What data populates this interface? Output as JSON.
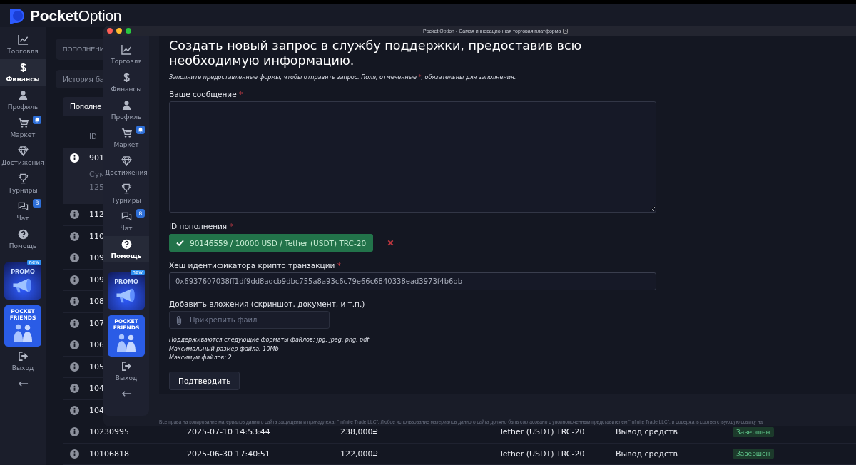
{
  "app": {
    "logo": "**Pocket**Option",
    "sidebar": {
      "items": [
        {
          "label": "Торговля",
          "selected": false
        },
        {
          "label": "Финансы",
          "selected": true
        },
        {
          "label": "Профиль",
          "selected": false
        },
        {
          "label": "Маркет",
          "selected": false,
          "alert": true
        },
        {
          "label": "Достижения",
          "selected": false
        },
        {
          "label": "Турниры",
          "selected": false
        },
        {
          "label": "Чат",
          "selected": false,
          "badge": "8"
        },
        {
          "label": "Помощь",
          "selected": false
        }
      ],
      "promo": {
        "label": "PROMO",
        "badge": "new"
      },
      "friends": {
        "label": "POCKET FRIENDS"
      },
      "logout": "Выход"
    },
    "tabs": [
      "ПОПОЛНЕНИ",
      "История ба"
    ],
    "filter": "Пополне",
    "table": {
      "columns": [
        "ID"
      ],
      "rows": [
        {
          "id": "901",
          "expanded": true,
          "details": [
            "Сум",
            "125"
          ]
        },
        {
          "id": "112",
          "expanded": false
        },
        {
          "id": "110",
          "expanded": false
        },
        {
          "id": "109",
          "expanded": false
        },
        {
          "id": "109",
          "expanded": false
        },
        {
          "id": "108",
          "expanded": false
        },
        {
          "id": "107",
          "expanded": false
        },
        {
          "id": "106",
          "expanded": false
        },
        {
          "id": "105",
          "expanded": false
        },
        {
          "id": "104",
          "expanded": false
        },
        {
          "id": "104",
          "expanded": false
        },
        {
          "id": "10230995",
          "expanded": false,
          "date": "2025-07-10 14:53:44",
          "amount": "238,000₽",
          "method": "Tether (USDT) TRC-20",
          "type": "Вывод средств",
          "status": "Завершен"
        },
        {
          "id": "10106818",
          "expanded": false,
          "date": "2025-06-30 17:40:51",
          "amount": "122,000₽",
          "method": "Tether (USDT) TRC-20",
          "type": "Вывод средств",
          "status": "Завершен"
        }
      ]
    }
  },
  "window": {
    "title": "Pocket Option - Самая инновационная торговая платформа",
    "sidebar": {
      "items": [
        {
          "label": "Торговля",
          "selected": false
        },
        {
          "label": "Финансы",
          "selected": false
        },
        {
          "label": "Профиль",
          "selected": false
        },
        {
          "label": "Маркет",
          "selected": false,
          "alert": true
        },
        {
          "label": "Достижения",
          "selected": false
        },
        {
          "label": "Турниры",
          "selected": false
        },
        {
          "label": "Чат",
          "selected": false,
          "badge": "8"
        },
        {
          "label": "Помощь",
          "selected": true
        }
      ],
      "promo": {
        "label": "PROMO",
        "badge": "new"
      },
      "friends": {
        "label": "POCKET FRIENDS"
      },
      "logout": "Выход"
    },
    "form": {
      "title": "Создать новый запрос в службу поддержки, предоставив всю необходимую информацию.",
      "note": {
        "before": "Заполните предоставленные формы, чтобы отправить запрос. Поля, отмеченные ",
        "mark": "*",
        "after": ", обязательны для заполнения."
      },
      "message": {
        "label": "Ваше сообщение",
        "required": "*"
      },
      "deposit": {
        "label": "ID пополнения",
        "required": "*",
        "value": "90146559 / 10000 USD / Tether (USDT) TRC-20",
        "verified": true
      },
      "hash": {
        "label": "Хеш идентификатора крипто транзакции",
        "required": "*",
        "value": "0x6937607038ff1df9dd8adcb9dbc755a8a93c6c79e66c6840338ead3973f4b6db"
      },
      "attach": {
        "label": "Добавить вложения (скриншот, документ, и т.п.)",
        "placeholder": "Прикрепить файл",
        "hints": [
          "Поддерживаются следующие форматы файлов: jpg, jpeg, png, pdf",
          "Максимальный размер файла: 10Mb",
          "Максимум файлов: 2"
        ]
      },
      "submit": "Подтвердить"
    },
    "footer": [
      "Все права на копирование материалов данного сайта защищены и принадлежат \"Infinite Trade LLC\". Любое использование материалов данного сайта должно быть согласовано с уполномоченным представителем \"Infinite Trade LLC\", и содержать соответствующую ссылку на"
    ]
  }
}
